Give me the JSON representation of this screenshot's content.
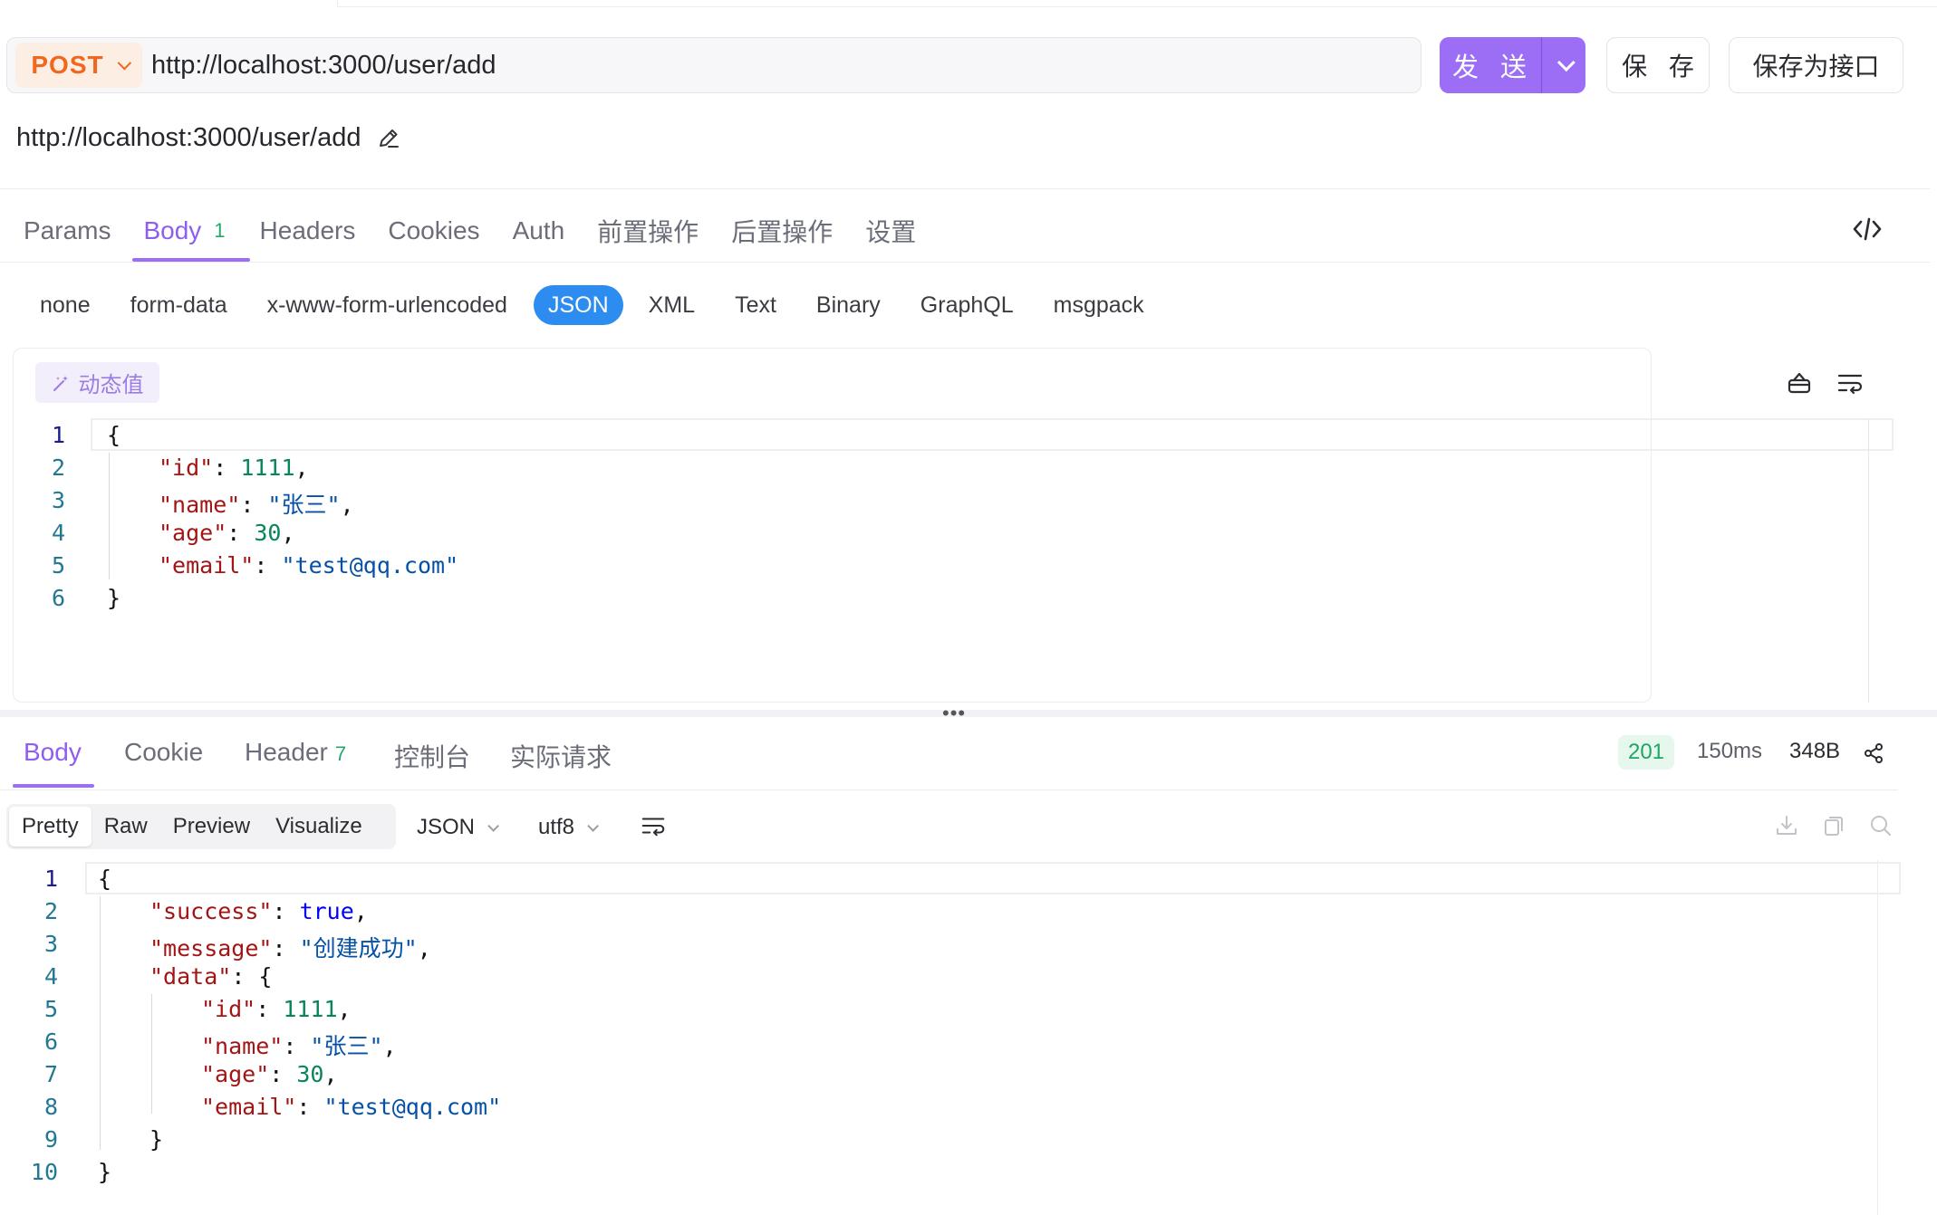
{
  "request": {
    "method": "POST",
    "url": "http://localhost:3000/user/add",
    "url_preview": "http://localhost:3000/user/add",
    "send_label": "发 送",
    "save_label": "保 存",
    "save_as_api_label": "保存为接口"
  },
  "request_tabs": [
    {
      "label": "Params"
    },
    {
      "label": "Body",
      "badge": "1"
    },
    {
      "label": "Headers"
    },
    {
      "label": "Cookies"
    },
    {
      "label": "Auth"
    },
    {
      "label": "前置操作"
    },
    {
      "label": "后置操作"
    },
    {
      "label": "设置"
    }
  ],
  "body_types": [
    "none",
    "form-data",
    "x-www-form-urlencoded",
    "JSON",
    "XML",
    "Text",
    "Binary",
    "GraphQL",
    "msgpack"
  ],
  "dynamic_value_label": "动态值",
  "request_body_lines": [
    "1",
    "2",
    "3",
    "4",
    "5",
    "6"
  ],
  "request_body": {
    "l1": "{",
    "l2k": "\"id\"",
    "l2v": "1111",
    "l3k": "\"name\"",
    "l3v": "\"张三\"",
    "l4k": "\"age\"",
    "l4v": "30",
    "l5k": "\"email\"",
    "l5v": "\"test@qq.com\"",
    "l6": "}"
  },
  "response_tabs": [
    {
      "label": "Body"
    },
    {
      "label": "Cookie"
    },
    {
      "label": "Header",
      "badge": "7"
    },
    {
      "label": "控制台"
    },
    {
      "label": "实际请求"
    }
  ],
  "response_meta": {
    "status": "201",
    "time": "150ms",
    "size": "348B"
  },
  "response_views": [
    "Pretty",
    "Raw",
    "Preview",
    "Visualize"
  ],
  "response_format": "JSON",
  "response_encoding": "utf8",
  "response_body_lines": [
    "1",
    "2",
    "3",
    "4",
    "5",
    "6",
    "7",
    "8",
    "9",
    "10"
  ],
  "response_body": {
    "l1": "{",
    "l2k": "\"success\"",
    "l2v": "true",
    "l3k": "\"message\"",
    "l3v": "\"创建成功\"",
    "l4k": "\"data\"",
    "l4v": "{",
    "l5k": "\"id\"",
    "l5v": "1111",
    "l6k": "\"name\"",
    "l6v": "\"张三\"",
    "l7k": "\"age\"",
    "l7v": "30",
    "l8k": "\"email\"",
    "l8v": "\"test@qq.com\"",
    "l9": "}",
    "l10": "}"
  },
  "colors": {
    "accent": "#9c6ef5",
    "method": "#f2671e",
    "json_pill": "#2d8cf0",
    "status_ok": "#20a565"
  }
}
